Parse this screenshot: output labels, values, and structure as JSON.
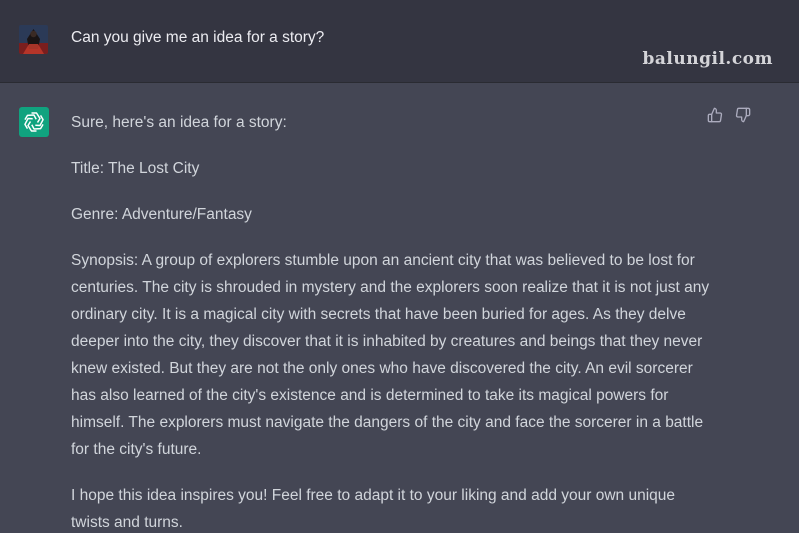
{
  "user": {
    "message": "Can you give me an idea for a story?",
    "avatar_icon": "user-avatar"
  },
  "watermark": "balungil.com",
  "assistant": {
    "avatar_icon": "openai-logo-icon",
    "paragraphs": [
      "Sure, here's an idea for a story:",
      "Title: The Lost City",
      "Genre: Adventure/Fantasy",
      "Synopsis: A group of explorers stumble upon an ancient city that was believed to be lost for centuries. The city is shrouded in mystery and the explorers soon realize that it is not just any ordinary city. It is a magical city with secrets that have been buried for ages. As they delve deeper into the city, they discover that it is inhabited by creatures and beings that they never knew existed. But they are not the only ones who have discovered the city. An evil sorcerer has also learned of the city's existence and is determined to take its magical powers for himself. The explorers must navigate the dangers of the city and face the sorcerer in a battle for the city's future.",
      "I hope this idea inspires you! Feel free to adapt it to your liking and add your own unique twists and turns."
    ],
    "feedback_icons": [
      "thumbs-up-icon",
      "thumbs-down-icon"
    ]
  },
  "colors": {
    "user_bg": "#343541",
    "assistant_bg": "#444654",
    "brand_green": "#10a37f",
    "text": "#d1d5db"
  }
}
